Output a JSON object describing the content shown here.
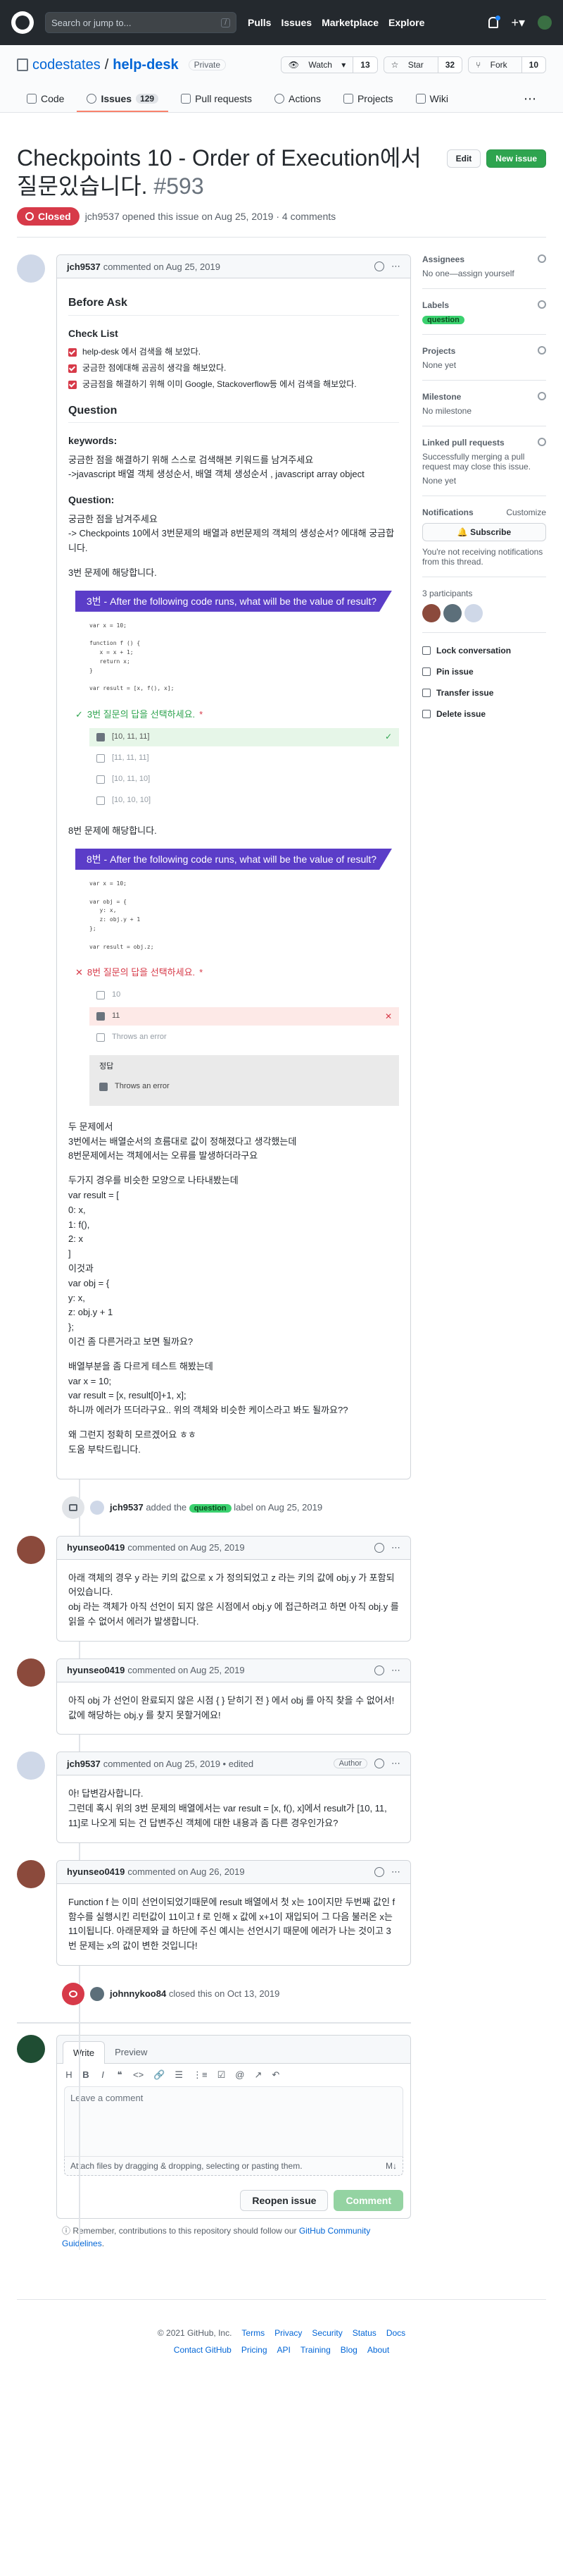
{
  "header": {
    "search_placeholder": "Search or jump to...",
    "slash": "/",
    "nav": [
      "Pulls",
      "Issues",
      "Marketplace",
      "Explore"
    ]
  },
  "repo": {
    "owner": "codestates",
    "sep": "/",
    "name": "help-desk",
    "visibility": "Private",
    "watch": {
      "label": "Watch",
      "count": "13"
    },
    "star": {
      "label": "Star",
      "count": "32"
    },
    "fork": {
      "label": "Fork",
      "count": "10"
    }
  },
  "tabs": [
    {
      "label": "Code"
    },
    {
      "label": "Issues",
      "count": "129"
    },
    {
      "label": "Pull requests"
    },
    {
      "label": "Actions"
    },
    {
      "label": "Projects"
    },
    {
      "label": "Wiki"
    }
  ],
  "issue": {
    "title": "Checkpoints 10 - Order of Execution에서 질문있습니다.",
    "number": "#593",
    "edit": "Edit",
    "new_issue": "New issue",
    "status": "Closed",
    "meta": "jch9537 opened this issue on Aug 25, 2019 · 4 comments"
  },
  "first_comment": {
    "author": "jch9537",
    "date": "commented on Aug 25, 2019",
    "h_before": "Before Ask",
    "h_checklist": "Check List",
    "checks": [
      "help-desk 에서 검색을 해 보았다.",
      "궁금한 점에대해 곰곰히 생각을 해보았다.",
      "궁금점을 해결하기 위해 이미 Google, Stackoverflow등 에서 검색을 해보았다."
    ],
    "h_question": "Question",
    "h_keywords": "keywords:",
    "keywords_text": [
      "궁금한 점을 해결하기 위해 스스로 검색해본 키워드를 남겨주세요",
      "->javascript 배열 객체 생성순서, 배열 객체 생성순서 , javascript array object"
    ],
    "h_question2": "Question:",
    "question_text": [
      "궁금한 점을 남겨주세요",
      "-> Checkpoints 10에서 3번문제의 배열과 8번문제의 객체의 생성순서? 에대해 궁금합니다."
    ],
    "q3": {
      "intro": "3번 문제에 해당합니다.",
      "banner": "3번 - After the following code runs, what will be the value of result?",
      "code": "var x = 10;\n\nfunction f () {\n   x = x + 1;\n   return x;\n}\n\nvar result = [x, f(), x];",
      "prompt": "3번 질문의 답을 선택하세요.",
      "options": [
        "[10, 11, 11]",
        "[11, 11, 11]",
        "[10, 11, 10]",
        "[10, 10, 10]"
      ],
      "star": "*",
      "mark": "✓",
      "check": "✓"
    },
    "q8": {
      "intro": "8번 문제에 해당합니다.",
      "banner": "8번 - After the following code runs, what will be the value of result?",
      "code": "var x = 10;\n\nvar obj = {\n   y: x,\n   z: obj.y + 1\n};\n\nvar result = obj.z;",
      "prompt": "8번 질문의 답을 선택하세요.",
      "options": [
        "10",
        "11",
        "Throws an error"
      ],
      "star": "*",
      "mark": "✕",
      "cross": "✕",
      "correct_label": "정답",
      "correct_option": "Throws an error"
    },
    "tail": [
      "두 문제에서",
      "3번에서는 배열순서의 흐름대로 값이 정해졌다고 생각했는데",
      "8번문제에서는 객체에서는 오류를 발생하더라구요",
      "두가지 경우를 비슷한 모양으로 나타내봤는데",
      "var result = [",
      "0: x,",
      "1: f(),",
      "2: x",
      "]",
      "이것과",
      "var obj = {",
      "y: x,",
      "z: obj.y + 1",
      "};",
      "이건 좀 다른거라고 보면 될까요?",
      "배열부분을 좀 다르게 테스트 해봤는데",
      "var x = 10;",
      "var result = [x, result[0]+1, x];",
      "하니까 에러가 뜨더라구요.. 위의 객체와 비슷한 케이스라고 봐도 될까요??",
      "왜 그런지 정확히 모르겠어요 ㅎㅎ",
      "도움 부탁드립니다."
    ]
  },
  "label_event": {
    "author": "jch9537",
    "text_before": "added the",
    "label": "question",
    "text_after": "label on Aug 25, 2019"
  },
  "comments": [
    {
      "author": "hyunseo0419",
      "date": "commented on Aug 25, 2019",
      "body": "아래 객체의 경우 y 라는 키의 값으로 x 가 정의되었고 z 라는 키의 값에 obj.y 가 포함되어있습니다.\nobj 라는 객체가 아직 선언이 되지 않은 시점에서 obj.y 에 접근하려고 하면 아직 obj.y 를 읽을 수 없어서 에러가 발생합니다."
    },
    {
      "author": "hyunseo0419",
      "date": "commented on Aug 25, 2019",
      "body": "아직 obj 가 선언이 완료되지 않은 시점 { } 닫히기 전 } 에서 obj 를 아직 찾을 수 없어서! 값에 해당하는 obj.y 를 찾지 못할거에요!"
    },
    {
      "author": "jch9537",
      "date": "commented on Aug 25, 2019 • edited",
      "role": "Author",
      "body": "아! 답변감사합니다.\n그런데 혹시 위의 3번 문제의 배열에서는 var result = [x, f(), x]에서 result가 [10, 11, 11]로 나오게 되는 건 답변주신 객체에 대한 내용과 좀 다른 경우인가요?"
    },
    {
      "author": "hyunseo0419",
      "date": "commented on Aug 26, 2019",
      "body": "Function f 는 이미 선언이되었기때문에 result 배열에서 첫 x는 10이지만 두번째 값인 f 함수를 실행시킨 리턴값이 11이고 f 로 인해 x 값에 x+1이 재입되어 그 다음 불러온 x는 11이됩니다. 아래문제와 글 하단에 주신 예시는 선언시기 때문에 에러가 나는 것이고 3번 문제는 x의 값이 변한 것입니다!"
    }
  ],
  "closed_event": {
    "author": "johnnykoo84",
    "text": "closed this on Oct 13, 2019"
  },
  "new_comment": {
    "tab_write": "Write",
    "tab_preview": "Preview",
    "toolbar": [
      "H",
      "B",
      "I",
      "❝",
      "<>",
      "🔗",
      "☰",
      "⋮≡",
      "☑",
      "@",
      "↗",
      "↶"
    ],
    "placeholder": "Leave a comment",
    "attach": "Attach files by dragging & dropping, selecting or pasting them.",
    "md": "M↓",
    "reopen": "Reopen issue",
    "comment": "Comment"
  },
  "contrib": {
    "text": "Remember, contributions to this repository should follow our",
    "link": "GitHub Community Guidelines",
    "end": "."
  },
  "sidebar": {
    "assignees": {
      "title": "Assignees",
      "value": "No one—assign yourself"
    },
    "labels": {
      "title": "Labels",
      "value": "question"
    },
    "projects": {
      "title": "Projects",
      "value": "None yet"
    },
    "milestone": {
      "title": "Milestone",
      "value": "No milestone"
    },
    "linked": {
      "title": "Linked pull requests",
      "value": "Successfully merging a pull request may close this issue.",
      "value2": "None yet"
    },
    "notifications": {
      "title": "Notifications",
      "customize": "Customize",
      "button": "Subscribe",
      "note": "You're not receiving notifications from this thread."
    },
    "participants": {
      "title": "3 participants"
    },
    "actions": [
      "Lock conversation",
      "Pin issue",
      "Transfer issue",
      "Delete issue"
    ]
  },
  "footer": {
    "copyright": "© 2021 GitHub, Inc.",
    "row1": [
      "Terms",
      "Privacy",
      "Security",
      "Status",
      "Docs"
    ],
    "row2": [
      "Contact GitHub",
      "Pricing",
      "API",
      "Training",
      "Blog",
      "About"
    ]
  }
}
